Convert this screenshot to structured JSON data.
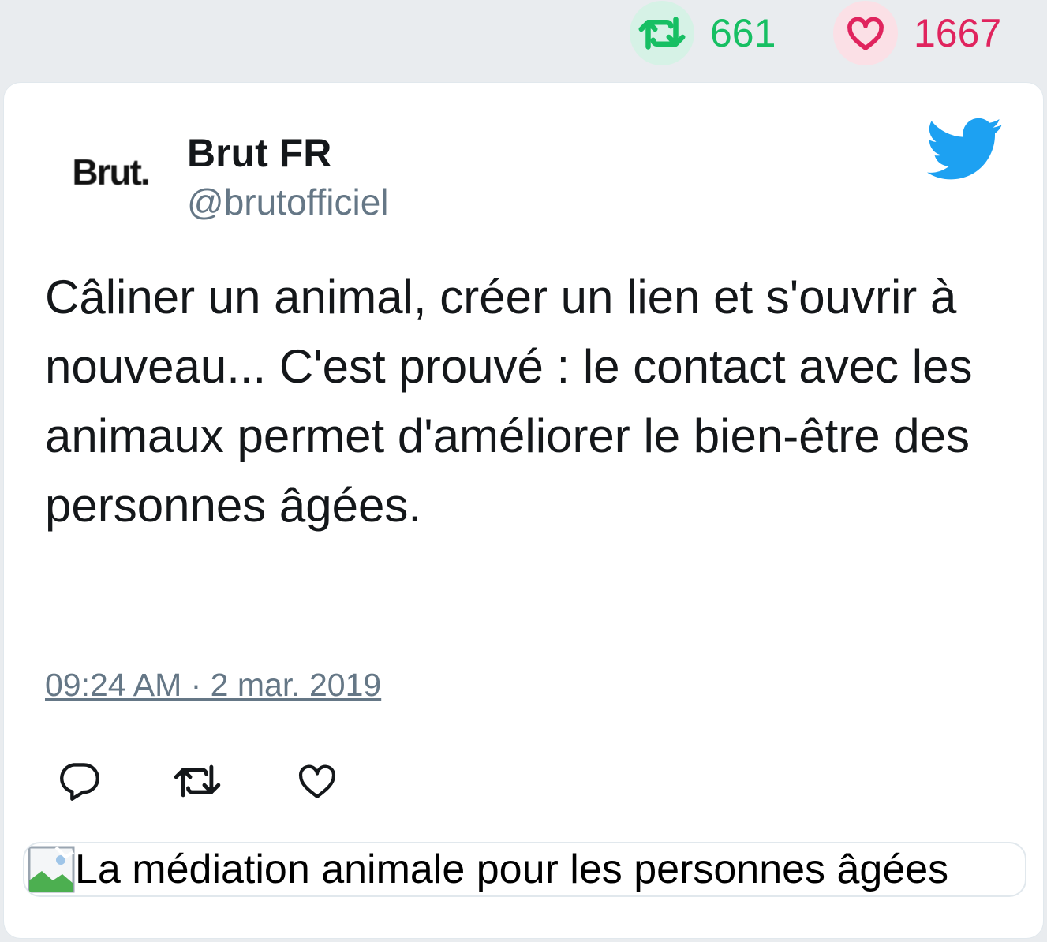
{
  "stats": {
    "retweets": "661",
    "likes": "1667",
    "retweet_color": "#17bf63",
    "like_color": "#e0245e"
  },
  "tweet": {
    "author_name": "Brut FR",
    "author_handle": "@brutofficiel",
    "avatar_text": "Brut.",
    "text": "Câliner un animal, créer un lien et s'ouvrir à nouveau... C'est prouvé : le contact avec les animaux permet d'améliorer le bien-être des personnes âgées.",
    "timestamp": "09:24 AM · 2 mar. 2019",
    "media_alt": "La médiation animale pour les personnes âgées"
  },
  "icons": {
    "brand": "twitter-bird-icon",
    "actions": [
      "reply-icon",
      "retweet-icon",
      "like-icon"
    ]
  },
  "colors": {
    "twitter_blue": "#1da1f2",
    "secondary_text": "#657786"
  }
}
